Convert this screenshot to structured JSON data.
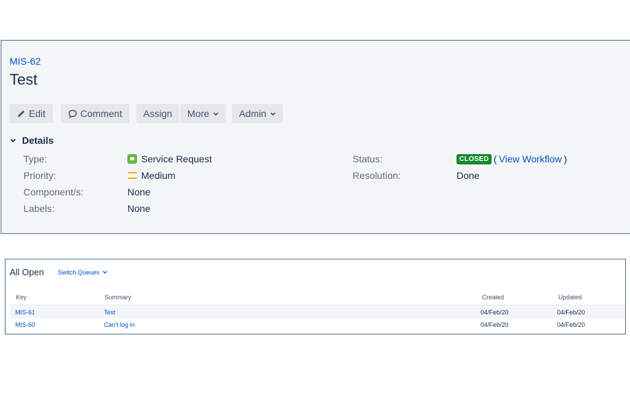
{
  "issue": {
    "key": "MIS-62",
    "title": "Test"
  },
  "toolbar": {
    "edit_label": "Edit",
    "comment_label": "Comment",
    "assign_label": "Assign",
    "more_label": "More",
    "admin_label": "Admin"
  },
  "details": {
    "heading": "Details",
    "type_label": "Type:",
    "type_value": "Service Request",
    "priority_label": "Priority:",
    "priority_value": "Medium",
    "components_label": "Component/s:",
    "components_value": "None",
    "labels_label": "Labels:",
    "labels_value": "None",
    "status_label": "Status:",
    "status_value": "CLOSED",
    "view_workflow_label": "View Workflow",
    "resolution_label": "Resolution:",
    "resolution_value": "Done"
  },
  "queue": {
    "title": "All Open",
    "switch_label": "Switch Queues",
    "columns": {
      "key": "Key",
      "summary": "Summary",
      "created": "Created",
      "updated": "Updated"
    },
    "rows": [
      {
        "key": "MIS-61",
        "summary": "Test",
        "created": "04/Feb/20",
        "updated": "04/Feb/20"
      },
      {
        "key": "MIS-60",
        "summary": "Can't log in",
        "created": "04/Feb/20",
        "updated": "04/Feb/20"
      }
    ]
  },
  "colors": {
    "link": "#0052cc",
    "status_closed": "#14892c",
    "type_service_request": "#65ba43",
    "priority_medium": "#ffab00"
  }
}
